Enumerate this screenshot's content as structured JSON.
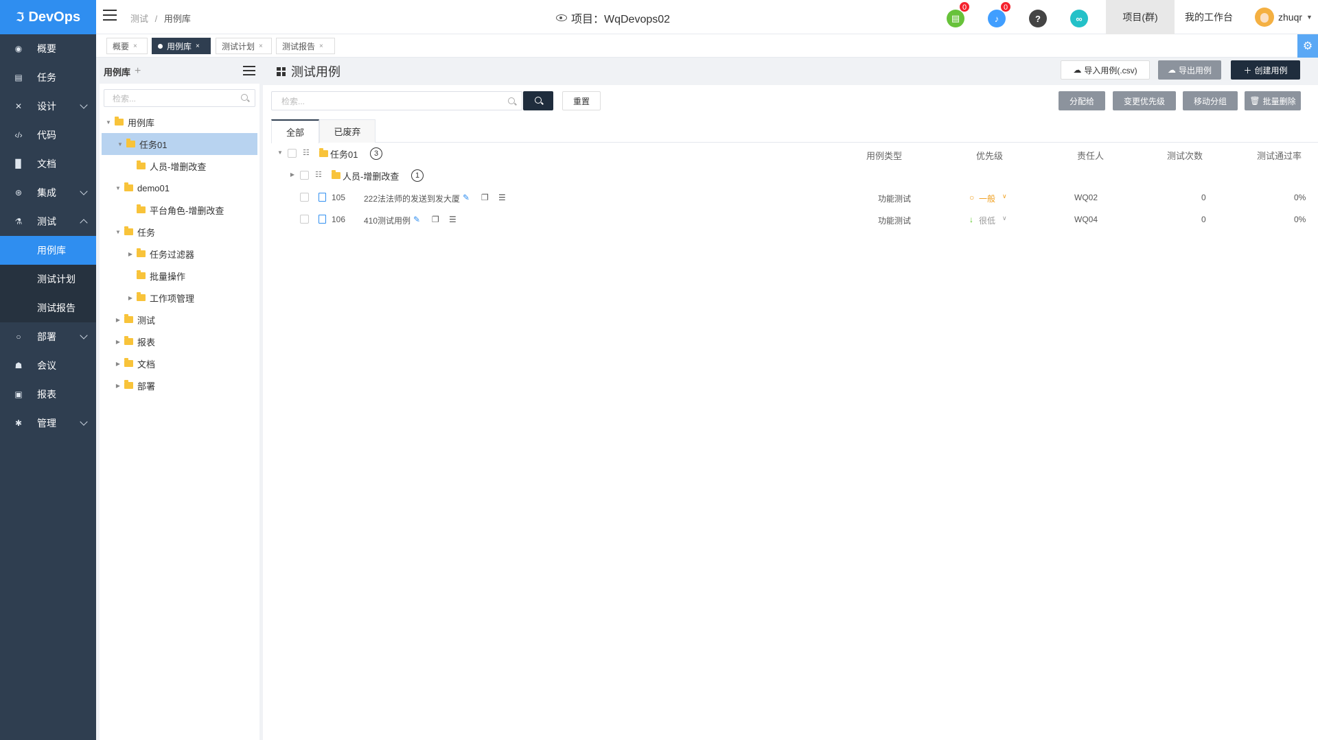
{
  "app": {
    "name": "DevOps"
  },
  "sidebar": {
    "items": [
      {
        "label": "概要",
        "icon": "dashboard-icon"
      },
      {
        "label": "任务",
        "icon": "task-icon"
      },
      {
        "label": "设计",
        "icon": "design-icon"
      },
      {
        "label": "代码",
        "icon": "code-icon"
      },
      {
        "label": "文档",
        "icon": "document-icon"
      },
      {
        "label": "集成",
        "icon": "integration-icon"
      },
      {
        "label": "测试",
        "icon": "flask-icon"
      },
      {
        "label": "部署",
        "icon": "deploy-icon"
      },
      {
        "label": "会议",
        "icon": "meeting-icon"
      },
      {
        "label": "报表",
        "icon": "report-icon"
      },
      {
        "label": "管理",
        "icon": "gear-icon"
      }
    ],
    "test_sub": [
      "用例库",
      "测试计划",
      "测试报告"
    ]
  },
  "topbar": {
    "breadcrumb": [
      "测试",
      "/",
      "用例库"
    ],
    "project_label": "项目：WqDevops02",
    "badge_tasks": "0",
    "badge_notifications": "0",
    "help_glyph": "?",
    "nav_project": "项目(群)",
    "nav_workspace": "我的工作台",
    "username": "zhuqr"
  },
  "page_tabs": [
    {
      "label": "概要"
    },
    {
      "label": "用例库"
    },
    {
      "label": "测试计划"
    },
    {
      "label": "测试报告"
    }
  ],
  "tree": {
    "title": "用例库",
    "search_placeholder": "检索...",
    "nodes": [
      {
        "label": "用例库"
      },
      {
        "label": "任务01"
      },
      {
        "label": "人员-增删改查"
      },
      {
        "label": "demo01"
      },
      {
        "label": "平台角色-增删改查"
      },
      {
        "label": "任务"
      },
      {
        "label": "任务过滤器"
      },
      {
        "label": "批量操作"
      },
      {
        "label": "工作项管理"
      },
      {
        "label": "测试"
      },
      {
        "label": "报表"
      },
      {
        "label": "文档"
      },
      {
        "label": "部署"
      }
    ]
  },
  "content": {
    "title": "测试用例",
    "import_label": "导入用例(.csv)",
    "export_label": "导出用例",
    "create_label": "创建用例",
    "search_placeholder": "检索...",
    "reset_label": "重置",
    "assign_label": "分配给",
    "change_priority_label": "变更优先级",
    "move_group_label": "移动分组",
    "batch_delete_label": "批量删除",
    "tabs": [
      "全部",
      "已废弃"
    ],
    "columns": [
      "用例类型",
      "优先级",
      "责任人",
      "测试次数",
      "测试通过率"
    ],
    "groups": [
      {
        "name": "任务01",
        "count": "3"
      },
      {
        "name": "人员-增删改查",
        "count": "1"
      }
    ],
    "rows": [
      {
        "id": "105",
        "title": "222法法师的发送到发大厦",
        "type": "功能测试",
        "priority": "一般",
        "owner": "WQ02",
        "runs": "0",
        "pass_rate": "0%"
      },
      {
        "id": "106",
        "title": "410测试用例",
        "type": "功能测试",
        "priority": "很低",
        "owner": "WQ04",
        "runs": "0",
        "pass_rate": "0%"
      }
    ]
  },
  "colors": {
    "accent": "#2f8ef0",
    "sidebar": "#2f3e50",
    "priority_normal": "#f0a020",
    "priority_low": "#52c41a"
  }
}
